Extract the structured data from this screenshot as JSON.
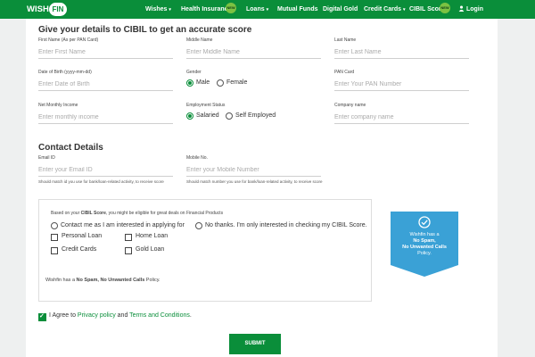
{
  "nav": {
    "logo_wish": "WISH",
    "logo_fin": "FIN",
    "items": [
      {
        "label": "Wishes"
      },
      {
        "label": "Health Insurance"
      },
      {
        "label": "Loans"
      },
      {
        "label": "Mutual Funds"
      },
      {
        "label": "Digital Gold"
      },
      {
        "label": "Credit Cards"
      },
      {
        "label": "CIBIL Score"
      },
      {
        "label": "Login"
      }
    ],
    "new_badge": "NEW",
    "dropdown_caret": "▾"
  },
  "form": {
    "heading": "Give your details to CIBIL to get an accurate score",
    "first_name": {
      "label": "First Name (As per PAN Card)",
      "placeholder": "Enter First Name",
      "value": ""
    },
    "middle_name": {
      "label": "Middle Name",
      "placeholder": "Enter Middle Name",
      "value": ""
    },
    "last_name": {
      "label": "Last Name",
      "placeholder": "Enter Last Name",
      "value": ""
    },
    "dob": {
      "label": "Date of Birth (yyyy-mm-dd)",
      "placeholder": "Enter Date of Birth",
      "value": ""
    },
    "gender": {
      "label": "Gender",
      "options": [
        "Male",
        "Female"
      ],
      "selected": "Male"
    },
    "pan": {
      "label": "PAN Card",
      "placeholder": "Enter Your PAN Number",
      "value": ""
    },
    "income": {
      "label": "Net Monthly Income",
      "placeholder": "Enter monthly income",
      "value": ""
    },
    "employment": {
      "label": "Employment Status",
      "options": [
        "Salaried",
        "Self Employed"
      ],
      "selected": "Salaried"
    },
    "company": {
      "label": "Company name",
      "placeholder": "Enter company name",
      "value": ""
    },
    "contact_heading": "Contact Details",
    "email": {
      "label": "Email ID",
      "placeholder": "Enter your Email ID",
      "value": "",
      "hint": "Should match id you use for bank/loan-related activity, to receive score"
    },
    "mobile": {
      "label": "Mobile No.",
      "placeholder": "Enter your Mobile Number",
      "value": "",
      "hint": "Should match number you use for bank/loan-related activity, to receive score"
    }
  },
  "offers": {
    "intro_pre": "Based on your ",
    "intro_bold": "CIBIL Score",
    "intro_post": ", you might be eligible for great deals on Financial Products",
    "option_yes": "Contact me as I am interested in applying for",
    "option_no": "No thanks. I'm only interested in checking my CIBIL Score.",
    "products": [
      {
        "label": "Personal Loan"
      },
      {
        "label": "Home Loan"
      },
      {
        "label": "Credit Cards"
      },
      {
        "label": "Gold Loan"
      }
    ],
    "footer_pre": "Wishfin has a ",
    "footer_bold": "No Spam, No Unwanted Calls",
    "footer_post": " Policy.",
    "badge": {
      "line1": "Wishfin has a",
      "line2": "No Spam,",
      "line3": "No Unwanted Calls",
      "line4": "Policy."
    }
  },
  "agree": {
    "checked": true,
    "text_pre": "I Agree to ",
    "privacy": "Privacy policy",
    "mid": " and ",
    "terms": "Terms and Conditions",
    "end": "."
  },
  "submit_label": "SUBMIT",
  "colors": {
    "brand_green": "#0a8e3a",
    "badge_blue": "#3aa1d6",
    "new_badge": "#7cc242"
  }
}
